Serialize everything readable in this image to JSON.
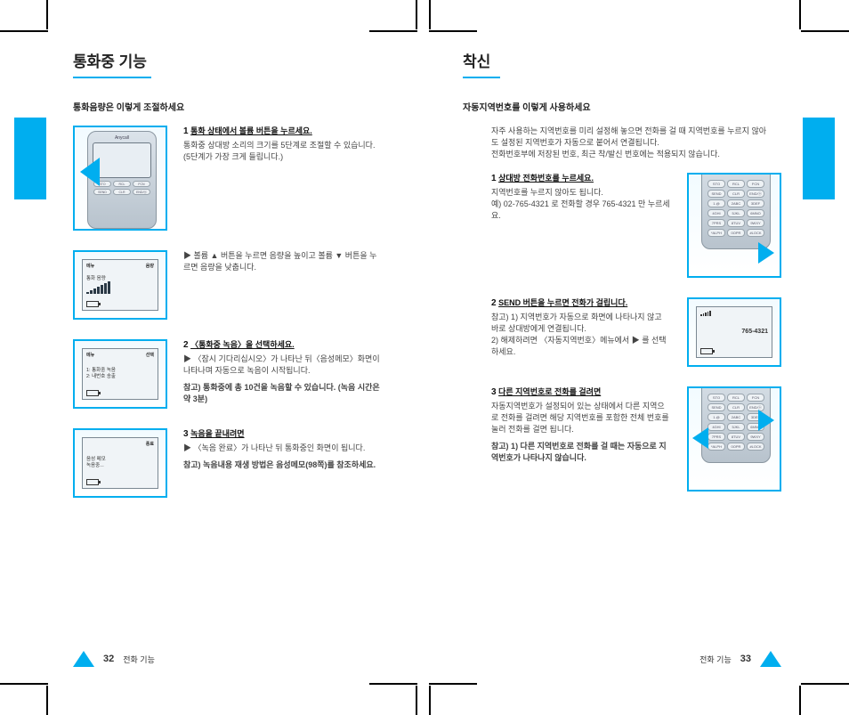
{
  "left": {
    "title": "통화중 기능",
    "subtitle": "통화음량은 이렇게 조절하세요",
    "steps": [
      {
        "num": "1",
        "head": "통화 상태에서 볼륨 버튼을 누르세요.",
        "body": "통화중 상대방 소리의 크기를 5단계로 조절할 수 있습니다. (5단계가 가장 크게 들립니다.)",
        "img": "phone_left_pointer"
      },
      {
        "num": "",
        "head": "",
        "body": "▶ 볼륨 ▲ 버튼을 누르면 음량을 높이고 볼륨 ▼ 버튼을 누르면 음량을 낮춥니다.",
        "img": "lcd_volume"
      },
      {
        "num": "2",
        "head": "〈통화중 녹음〉을 선택하세요.",
        "body": "▶ 〈잠시 기다리십시오〉가 나타난 뒤〈음성메모〉화면이 나타나며 자동으로 녹음이 시작됩니다.",
        "note": "참고) 통화중에 총 10건을 녹음할 수 있습니다. (녹음 시간은 약 3분)",
        "img": "lcd_record_menu"
      },
      {
        "num": "3",
        "head": "녹음을 끝내려면",
        "body": "▶ 〈녹음 완료〉가 나타난 뒤 통화중인 화면이 됩니다.",
        "note": "참고) 녹음내용 재생 방법은 음성메모(98쪽)를 참조하세요.",
        "img": "lcd_recording"
      }
    ],
    "foot_num": "32",
    "foot_label": "전화 기능"
  },
  "right": {
    "title": "착신",
    "subtitle": "자동지역번호를 이렇게 사용하세요",
    "intro": "자주 사용하는 지역번호를 미리 설정해 놓으면 전화를 걸 때 지역번호를 누르지 않아도 설정된 지역번호가 자동으로 붙어서 연결됩니다.\n전화번호부에 저장된 번호, 최근 착/발신 번호에는 적용되지 않습니다.",
    "steps": [
      {
        "num": "1",
        "head": "상대방 전화번호를 누르세요.",
        "body": "지역번호를 누르지 않아도 됩니다.\n예) 02-765-4321 로 전화할 경우 765-4321 만 누르세요.",
        "img": "keypad_num"
      },
      {
        "num": "2",
        "head": "SEND 버튼을 누르면 전화가 걸립니다.",
        "body": "참고) 1) 지역번호가 자동으로 화면에 나타나지 않고 바로 상대방에게 연결됩니다.\n2) 해제하려면 〈자동지역번호〉메뉴에서 ▶ 를 선택하세요.",
        "img": "lcd_dialing"
      },
      {
        "num": "3",
        "head": "다른 지역번호로 전화를 걸려면",
        "body": "자동지역번호가 설정되어 있는 상태에서 다른 지역으로 전화를 걸려면 해당 지역번호를 포함한 전체 번호를 눌러 전화를 걸면 됩니다.",
        "note": "참고) 1) 다른 지역번호로 전화를 걸 때는 자동으로 지역번호가 나타나지 않습니다.",
        "img": "keypad_full"
      }
    ],
    "foot_num": "33",
    "foot_label": "전화 기능"
  },
  "phone_brand": "Anycall",
  "keys_row1": [
    "STO",
    "RCL",
    "FCN"
  ],
  "keys_row2": [
    "SEND",
    "CLR",
    "END/ⓞ"
  ],
  "keys_digits": [
    "1.@",
    "2ABC",
    "3DEF",
    "4GHI",
    "5JKL",
    "6MNO",
    "7PRS",
    "8TUV",
    "9WXY",
    "*ALPH",
    "0OPR",
    "#LOCK"
  ],
  "lcd": {
    "volume": {
      "tl": "메뉴",
      "tr": "음량",
      "mid": "통화 음량"
    },
    "record_menu": {
      "tl": "메뉴",
      "tr": "선택",
      "line1": "1: 통화중 녹음",
      "line2": "2: 내번호 송출"
    },
    "recording": {
      "tr": "종료",
      "line1": "음성 메모",
      "line2": "녹음중..."
    },
    "dialing": {
      "mid": "765-4321"
    }
  }
}
